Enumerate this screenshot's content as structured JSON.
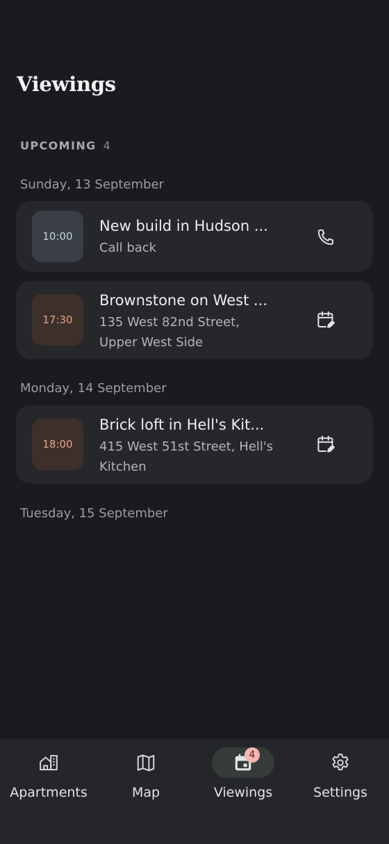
{
  "header": {
    "title": "Viewings"
  },
  "upcoming": {
    "label": "UPCOMING",
    "count": "4"
  },
  "days": [
    {
      "label": "Sunday, 13 September",
      "viewings": [
        {
          "time": "10:00",
          "title": "New build in Hudson ...",
          "sub1": "Call back",
          "sub2": "",
          "icon": "phone-icon"
        },
        {
          "time": "17:30",
          "title": "Brownstone on West ...",
          "sub1": "135 West 82nd Street,",
          "sub2": "Upper West Side",
          "icon": "calendar-edit-icon"
        }
      ]
    },
    {
      "label": "Monday, 14 September",
      "viewings": [
        {
          "time": "18:00",
          "title": "Brick loft in Hell's Kit...",
          "sub1": "415 West 51st Street, Hell's",
          "sub2": "Kitchen",
          "icon": "calendar-edit-icon"
        }
      ]
    },
    {
      "label": "Tuesday, 15 September",
      "viewings": []
    }
  ],
  "nav": {
    "items": [
      {
        "label": "Apartments",
        "icon": "apartments-icon"
      },
      {
        "label": "Map",
        "icon": "map-icon"
      },
      {
        "label": "Viewings",
        "icon": "calendar-icon",
        "badge": "4",
        "active": true
      },
      {
        "label": "Settings",
        "icon": "gear-icon"
      }
    ]
  },
  "colors": {
    "background": "#1a1b1e",
    "card": "#26272a",
    "time_blue_bg": "#3a3f47",
    "time_brown_bg": "#3d302b",
    "time_brown_text": "#e2a58c",
    "badge": "#f4b6b2",
    "active_pill": "#363c39"
  }
}
